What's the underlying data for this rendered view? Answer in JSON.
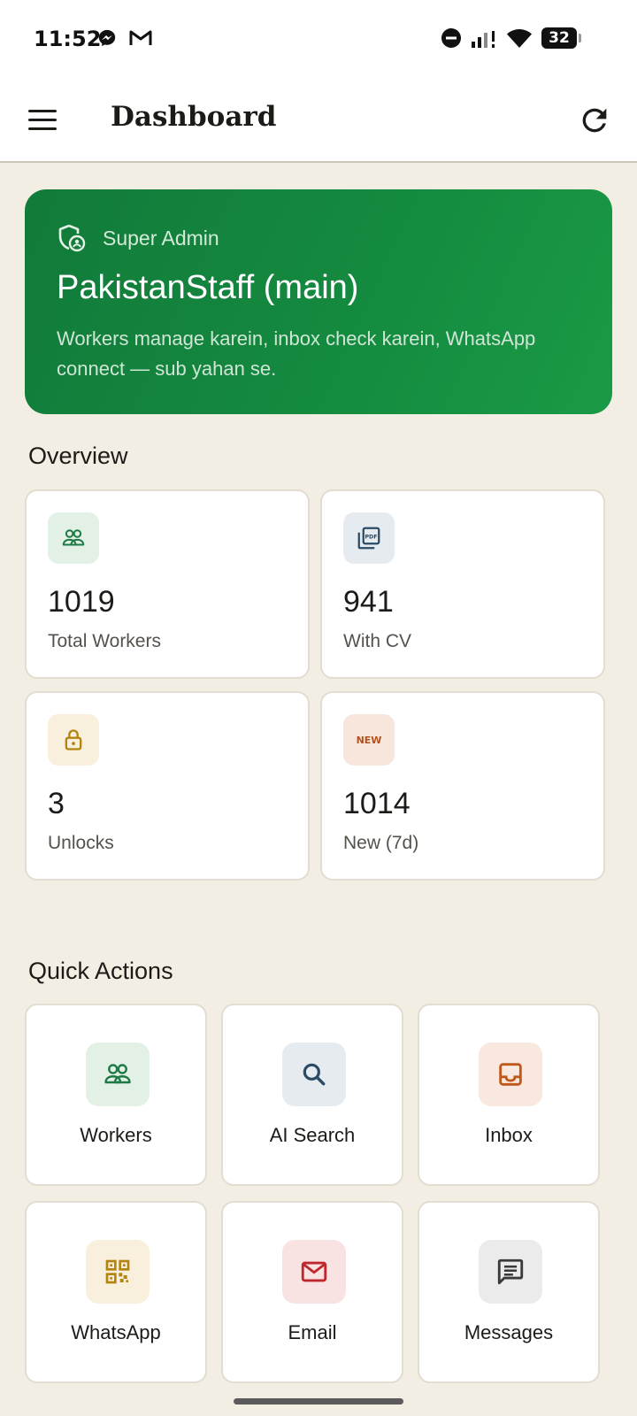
{
  "status_bar": {
    "time": "11:52",
    "battery": "32",
    "icons": [
      "messenger-icon",
      "gmail-icon",
      "do-not-disturb-icon",
      "signal-icon",
      "wifi-icon",
      "battery-icon"
    ]
  },
  "app_bar": {
    "title": "Dashboard",
    "menu_icon": "menu-icon",
    "refresh_icon": "refresh-icon"
  },
  "hero": {
    "role": "Super Admin",
    "title": "PakistanStaff (main)",
    "description": "Workers manage karein, inbox check karein, WhatsApp connect — sub yahan se.",
    "colors": {
      "gradient_start": "#127a3a",
      "gradient_end": "#1a9a46"
    }
  },
  "overview": {
    "title": "Overview",
    "stats": [
      {
        "value": "1019",
        "label": "Total Workers",
        "icon": "people-icon",
        "icon_color": "#1e7a45",
        "icon_bg": "#e3f0e6"
      },
      {
        "value": "941",
        "label": "With CV",
        "icon": "pdf-icon",
        "icon_color": "#2b4a66",
        "icon_bg": "#e6ebef"
      },
      {
        "value": "3",
        "label": "Unlocks",
        "icon": "lock-open-icon",
        "icon_color": "#b38410",
        "icon_bg": "#f8efdc"
      },
      {
        "value": "1014",
        "label": "New (7d)",
        "icon": "new-badge-icon",
        "icon_text": "NEW",
        "icon_color": "#b5521c",
        "icon_bg": "#f8e6dc"
      }
    ]
  },
  "quick_actions": {
    "title": "Quick Actions",
    "items": [
      {
        "label": "Workers",
        "icon": "people-icon",
        "icon_color": "#1e7a45",
        "icon_bg": "#e3f0e6"
      },
      {
        "label": "AI Search",
        "icon": "search-icon",
        "icon_color": "#2b4a66",
        "icon_bg": "#e6ebef"
      },
      {
        "label": "Inbox",
        "icon": "inbox-icon",
        "icon_color": "#c0581a",
        "icon_bg": "#f8e8df"
      },
      {
        "label": "WhatsApp",
        "icon": "qr-code-icon",
        "icon_color": "#b38410",
        "icon_bg": "#f8efdc"
      },
      {
        "label": "Email",
        "icon": "mail-icon",
        "icon_color": "#c0272d",
        "icon_bg": "#f8e2e2"
      },
      {
        "label": "Messages",
        "icon": "message-icon",
        "icon_color": "#3a3a3a",
        "icon_bg": "#ebebeb"
      }
    ]
  }
}
